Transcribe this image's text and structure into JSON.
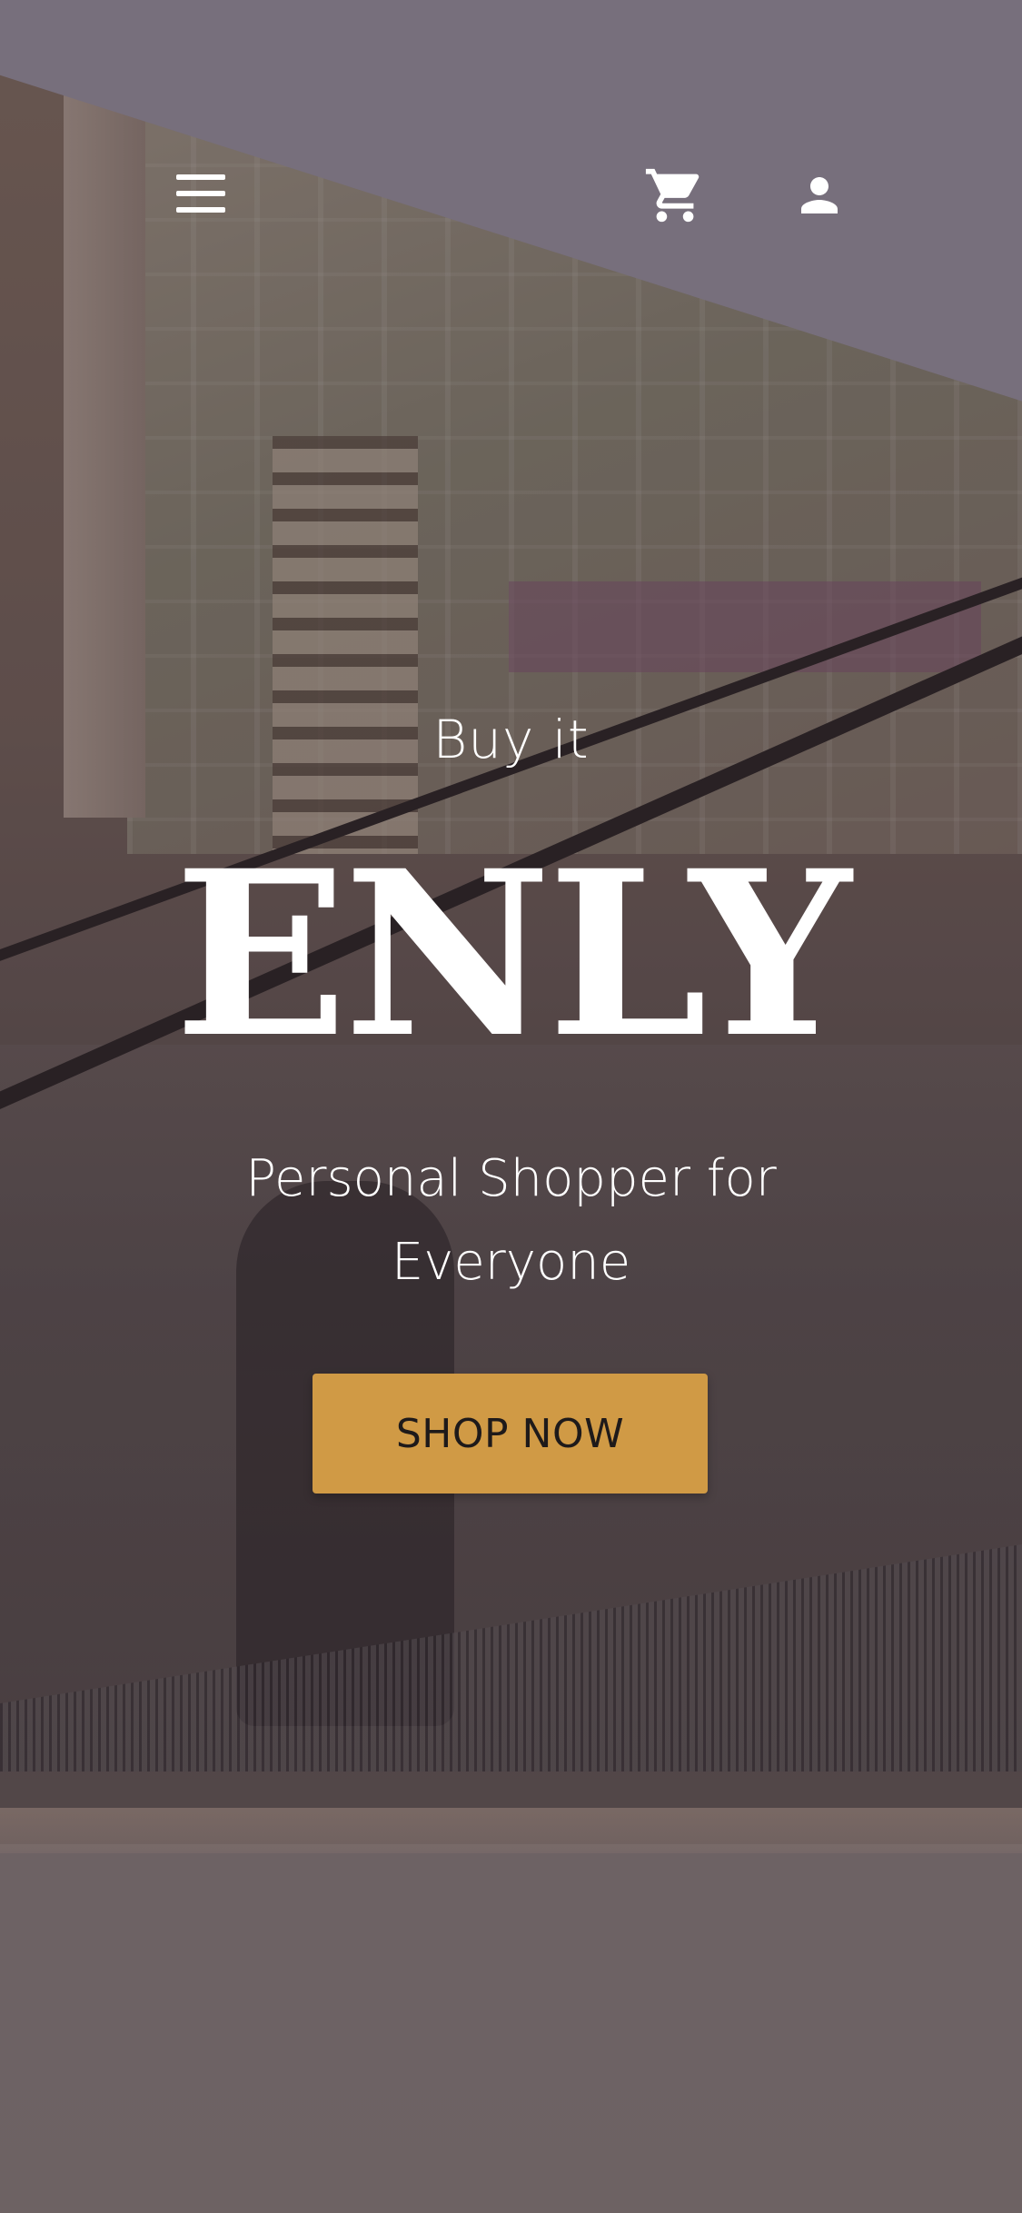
{
  "nav": {
    "icons": [
      "menu-icon",
      "cart-icon",
      "user-icon"
    ]
  },
  "hero": {
    "eyebrow": "Buy it",
    "brand": "ENLY",
    "tagline": "Personal Shopper for Everyone",
    "cta_label": "SHOP NOW"
  },
  "colors": {
    "accent": "#d09a45",
    "text": "#ffffff",
    "background": "#6f6466"
  }
}
